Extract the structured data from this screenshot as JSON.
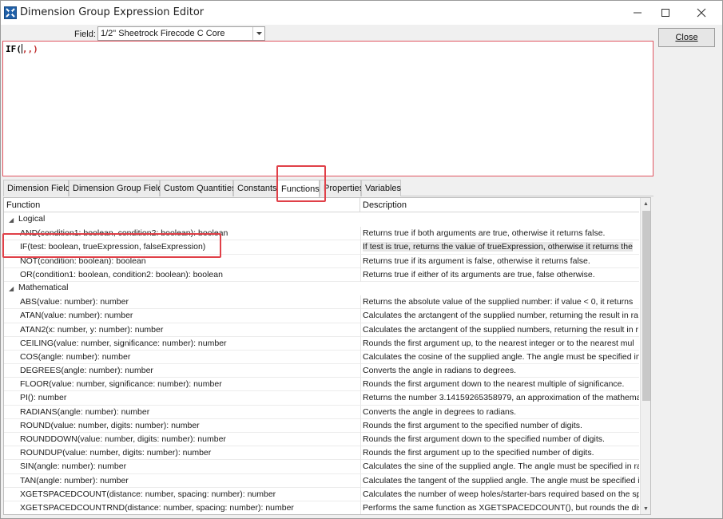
{
  "window": {
    "title": "Dimension Group Expression Editor",
    "controls": {
      "minimize": "minimize",
      "maximize": "maximize",
      "close": "close"
    }
  },
  "field": {
    "label": "Field:",
    "selected": "1/2\" Sheetrock Firecode C Core"
  },
  "close_button": {
    "label": "Close"
  },
  "editor": {
    "prefix": "IF(",
    "suffix": ",,)"
  },
  "tabs": [
    {
      "label": "Dimension Fields"
    },
    {
      "label": "Dimension Group Fields"
    },
    {
      "label": "Custom Quantities"
    },
    {
      "label": "Constants"
    },
    {
      "label": "Functions",
      "active": true
    },
    {
      "label": "Properties"
    },
    {
      "label": "Variables"
    }
  ],
  "grid": {
    "columns": {
      "function": "Function",
      "description": "Description"
    },
    "groups": [
      {
        "name": "Logical",
        "rows": [
          {
            "f": "AND(condition1: boolean, condition2: boolean): boolean",
            "d": "Returns true if both arguments are true, otherwise it returns false."
          },
          {
            "f": "IF(test: boolean, trueExpression, falseExpression)",
            "d": "If test is true, returns the value of trueExpression, otherwise it returns the"
          },
          {
            "f": "NOT(condition: boolean): boolean",
            "d": "Returns true if its argument is false, otherwise it returns false."
          },
          {
            "f": "OR(condition1: boolean, condition2: boolean): boolean",
            "d": "Returns true if either of its arguments are true, false otherwise."
          }
        ]
      },
      {
        "name": "Mathematical",
        "rows": [
          {
            "f": "ABS(value: number): number",
            "d": "Returns the absolute value of the supplied number: if value < 0, it returns"
          },
          {
            "f": "ATAN(value: number): number",
            "d": "Calculates the arctangent of the supplied number, returning the result in ra"
          },
          {
            "f": "ATAN2(x: number, y: number): number",
            "d": "Calculates the arctangent of the supplied numbers, returning the result in r"
          },
          {
            "f": "CEILING(value: number, significance: number): number",
            "d": "Rounds the first argument up, to the nearest integer or to the nearest mul"
          },
          {
            "f": "COS(angle: number): number",
            "d": "Calculates the cosine of the supplied angle. The angle must be specified in"
          },
          {
            "f": "DEGREES(angle: number): number",
            "d": "Converts the angle in radians to degrees."
          },
          {
            "f": "FLOOR(value: number, significance: number): number",
            "d": "Rounds the first argument down to the nearest multiple of significance."
          },
          {
            "f": "PI(): number",
            "d": "Returns the number 3.14159265358979, an approximation of the mathema"
          },
          {
            "f": "RADIANS(angle: number): number",
            "d": "Converts the angle in degrees to radians."
          },
          {
            "f": "ROUND(value: number, digits: number): number",
            "d": "Rounds the first argument to the specified number of digits."
          },
          {
            "f": "ROUNDDOWN(value: number, digits: number): number",
            "d": "Rounds the first argument down to the specified number of digits."
          },
          {
            "f": "ROUNDUP(value: number, digits: number): number",
            "d": "Rounds the first argument up to the specified number of digits."
          },
          {
            "f": "SIN(angle: number): number",
            "d": "Calculates the sine of the supplied angle. The angle must be specified in ra"
          },
          {
            "f": "TAN(angle: number): number",
            "d": "Calculates the tangent of the supplied angle. The angle must be specified i"
          },
          {
            "f": "XGETSPACEDCOUNT(distance: number, spacing: number): number",
            "d": "Calculates the number of weep holes/starter-bars required based on the sp"
          },
          {
            "f": "XGETSPACEDCOUNTRND(distance: number, spacing: number): number",
            "d": "Performs the same function as XGETSPACEDCOUNT(), but rounds the dista"
          }
        ]
      }
    ],
    "selected_function": "IF(test: boolean, trueExpression, falseExpression)"
  },
  "colors": {
    "highlight": "#e04048",
    "editor_border": "#e05560",
    "selected_row": "#e6e6e6"
  },
  "icons": [
    "app-icon",
    "minimize-icon",
    "maximize-icon",
    "close-icon",
    "dropdown-arrow-icon",
    "collapse-triangle-icon",
    "scroll-up-icon",
    "scroll-down-icon"
  ]
}
